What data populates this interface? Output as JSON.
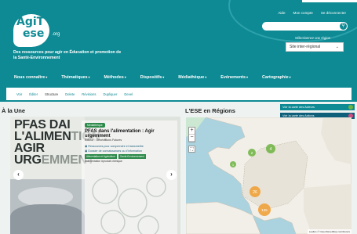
{
  "logo": {
    "line1": "AgiT",
    "line2": "ese",
    "suffix": ".org"
  },
  "tagline": "Des ressources pour agir en Éducation et promotion de la Santé-Environnement",
  "toplinks": [
    "Aide",
    "Mon compte",
    "Se déconnecter"
  ],
  "search": {
    "placeholder": "",
    "icon": "search-icon"
  },
  "region": {
    "label": "Sélectionnez une région",
    "selected": "Site inter-régional"
  },
  "nav": [
    "Nous connaître",
    "Thématiques",
    "Méthodes",
    "Dispositifs",
    "Médiathèque",
    "Evénements",
    "Cartographie"
  ],
  "tabs": [
    "Voir",
    "Éditer",
    "Structure",
    "Delete",
    "Révisions",
    "Dupliquer",
    "Devel"
  ],
  "active_tab": "Structure",
  "sections": {
    "une": "À la Une",
    "regions": "L'ESE en Régions"
  },
  "poster": {
    "line1": "PFAS DAI",
    "line2": "L'ALIMEN",
    "line2b": "TION :",
    "line3": "AGIR URG",
    "line3b": "EMMENT"
  },
  "card": {
    "badge": "Médiathèque",
    "title": "PFAS dans l'alimentation : Agir urgemment",
    "meta": "Éditeur : Générations Futures",
    "link1": "Ressources pour comprendre et transmettre",
    "link2": "Dossier de connaissances ou d'information",
    "tags": [
      "Alimentation et Agriculture",
      "Santé-Environnement"
    ],
    "keywords": "#alimentation   #produit chimique"
  },
  "map": {
    "btn_actors": "Voir la carte des Acteurs",
    "btn_actions": "Voir la carte des Actions",
    "zoom_in": "+",
    "zoom_out": "−",
    "fullscreen": "⛶",
    "attribution": "Leaflet | © OpenStreetMap contributors",
    "clusters": [
      {
        "label": "4",
        "color": "#6cb33f"
      },
      {
        "label": "2",
        "color": "#6cb33f"
      },
      {
        "label": "26",
        "color": "#f0a13a"
      },
      {
        "label": "135",
        "color": "#f0a13a"
      },
      {
        "label": "1",
        "color": "#6cb33f"
      }
    ]
  }
}
